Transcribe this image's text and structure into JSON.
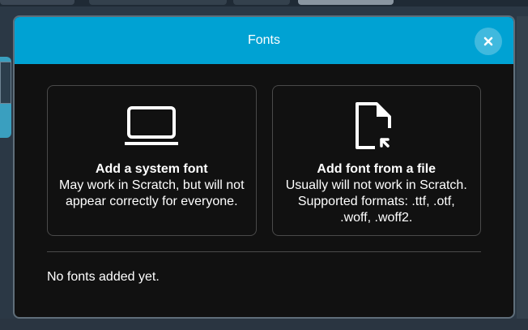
{
  "modal": {
    "title": "Fonts",
    "close_icon": "close-icon",
    "options": [
      {
        "icon": "laptop-icon",
        "title": "Add a system font",
        "description": "May work in Scratch, but will not appear correctly for everyone."
      },
      {
        "icon": "file-upload-icon",
        "title": "Add font from a file",
        "description": "Usually will not work in Scratch. Supported formats: .ttf, .otf, .woff, .woff2."
      }
    ],
    "empty_message": "No fonts added yet."
  },
  "colors": {
    "header": "#00a2d3",
    "modal_background": "#111111",
    "text": "#ffffff"
  }
}
